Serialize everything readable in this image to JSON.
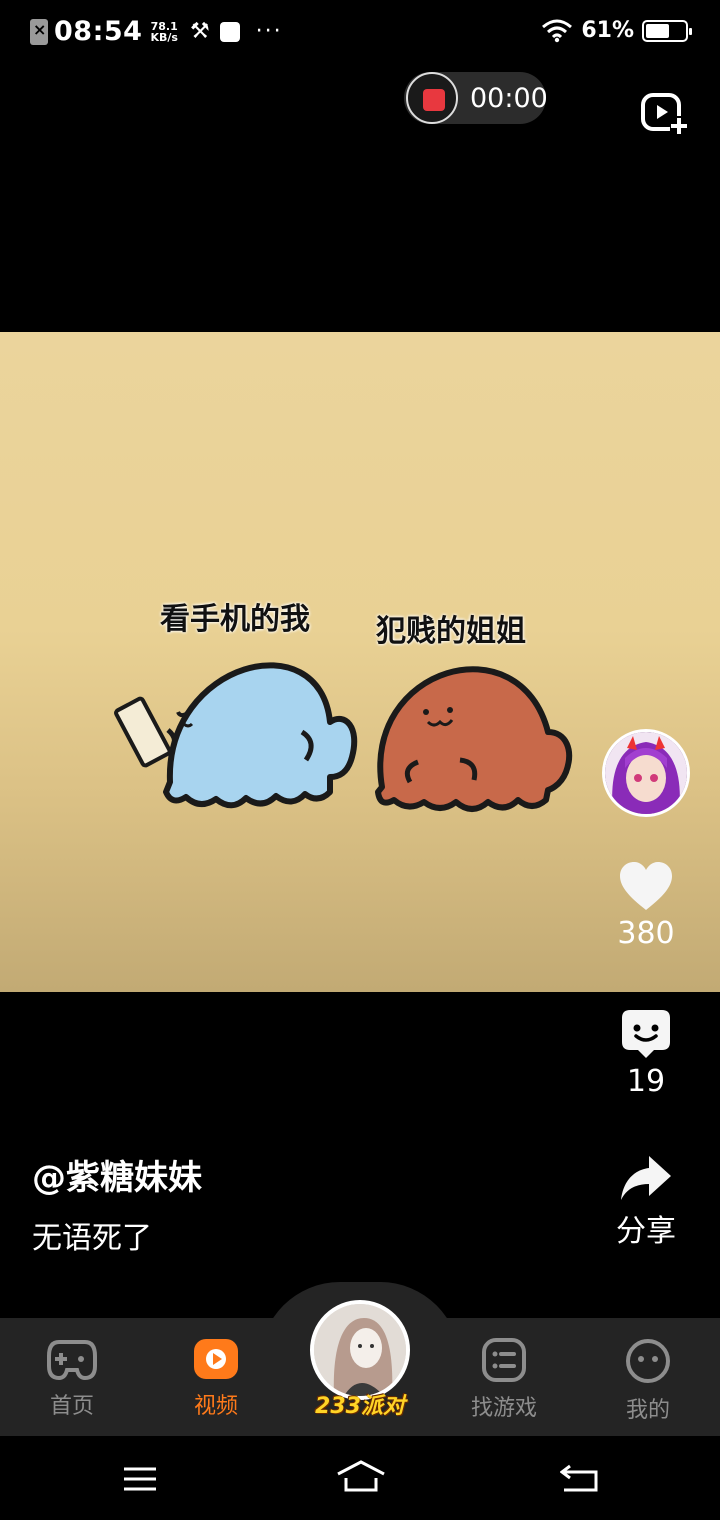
{
  "status_bar": {
    "time": "08:54",
    "speed_value": "78.1",
    "speed_unit": "KB/s",
    "battery": "61%",
    "battery_level": 0.61,
    "icons": [
      "sim-card-off-icon",
      "tools-icon",
      "app-square-icon",
      "more-dots-icon",
      "wifi-icon",
      "battery-icon"
    ]
  },
  "recorder": {
    "time": "00:00",
    "stop_icon": "record-stop-icon",
    "add_icon": "video-add-icon"
  },
  "video": {
    "caption_left": "看手机的我",
    "caption_right": "犯贱的姐姐"
  },
  "actions": {
    "like_count": "380",
    "comment_count": "19",
    "share_label": "分享",
    "icons": [
      "heart-icon",
      "comment-icon",
      "share-icon"
    ]
  },
  "post": {
    "author": "@紫糖妹妹",
    "description": "无语死了"
  },
  "tabs": [
    {
      "label": "首页",
      "icon": "gamepad-icon",
      "active": false
    },
    {
      "label": "视频",
      "icon": "video-play-icon",
      "active": true
    },
    {
      "label": "233派对",
      "icon": "party-avatar",
      "active": false
    },
    {
      "label": "找游戏",
      "icon": "game-list-icon",
      "active": false
    },
    {
      "label": "我的",
      "icon": "profile-face-icon",
      "active": false
    }
  ],
  "nav": {
    "icons": [
      "menu-icon",
      "home-icon",
      "back-icon"
    ]
  },
  "colors": {
    "accent": "#ff7a1a",
    "tabbar": "#242424",
    "video_bg": "#ebd49c",
    "blue_ghost": "#a8d4ef",
    "orange_ghost": "#c8694a",
    "record": "#e8383f"
  }
}
